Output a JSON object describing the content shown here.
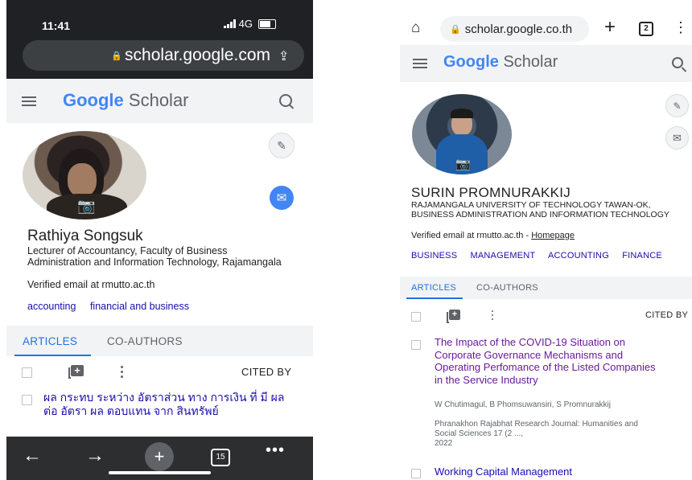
{
  "left": {
    "status": {
      "time": "11:41",
      "network": "4G"
    },
    "browser": {
      "url": "scholar.google.com"
    },
    "app": {
      "logo_google": "Google",
      "logo_scholar": "Scholar"
    },
    "profile": {
      "name": "Rathiya Songsuk",
      "affiliation": "Lecturer of Accountancy, Faculty of Business Administration and Information Technology, Rajamangala",
      "email": "Verified email at rmutto.ac.th",
      "interests": [
        "accounting",
        "financial and business"
      ]
    },
    "tabs": [
      {
        "label": "ARTICLES"
      },
      {
        "label": "CO-AUTHORS"
      }
    ],
    "table": {
      "cited_by": "CITED BY"
    },
    "article": {
      "title": "ผล กระทบ ระหว่าง อัตราส่วน ทาง การเงิน ที่ มี ผล ต่อ อัตรา ผล ตอบแทน จาก สินทรัพย์"
    },
    "nav": {
      "tab_count": "15"
    }
  },
  "right": {
    "browser": {
      "url": "scholar.google.co.th",
      "tab_count": "2"
    },
    "app": {
      "logo_google": "Google",
      "logo_scholar": "Scholar"
    },
    "profile": {
      "name": "SURIN PROMNURAKKIJ",
      "affiliation": "RAJAMANGALA UNIVERSITY OF TECHNOLOGY TAWAN-OK, BUSINESS ADMINISTRATION AND INFORMATION TECHNOLOGY",
      "email": "Verified email at rmutto.ac.th",
      "email_sep": " - ",
      "homepage": "Homepage",
      "interests": [
        "BUSINESS",
        "MANAGEMENT",
        "ACCOUNTING",
        "FINANCE"
      ]
    },
    "tabs": [
      {
        "label": "ARTICLES"
      },
      {
        "label": "CO-AUTHORS"
      }
    ],
    "table": {
      "cited_by": "CITED BY"
    },
    "articles": [
      {
        "title": "The Impact of the COVID-19 Situation on Corporate Governance Mechanisms and Operating Perfomance of the Listed Companies in the Service Industry",
        "authors": "W Chutimagul, B Phomsuwansiri, S Promnurakkij",
        "venue": "Phranakhon Rajabhat Research Journal: Humanities and Social Sciences 17 (2 ...,",
        "year": "2022"
      },
      {
        "title": "Working Capital Management"
      }
    ]
  },
  "colors": {
    "link_blue": "#1a0dab",
    "tab_blue": "#1a73e8",
    "visited_purple": "#6a1b9a",
    "mail_blue": "#4285f4",
    "dark_bar": "#202124"
  }
}
